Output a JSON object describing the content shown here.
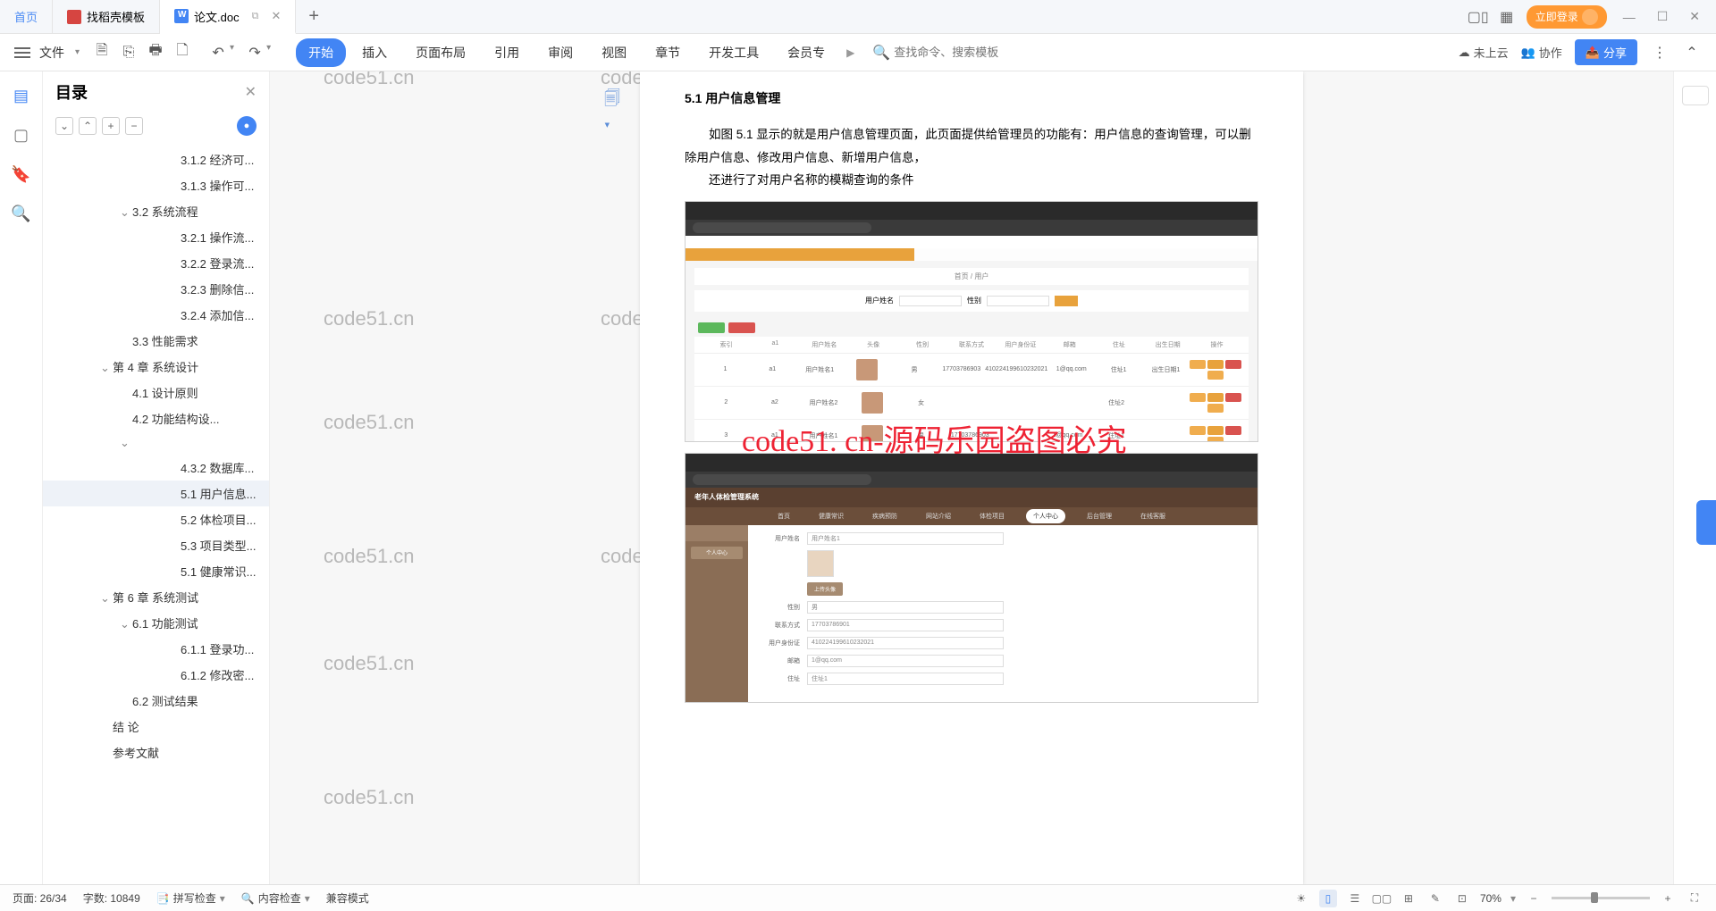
{
  "tabs": {
    "home": "首页",
    "t1": "找稻壳模板",
    "t2": "论文.doc"
  },
  "login_btn": "立即登录",
  "ribbon": {
    "file": "文件",
    "tabs": [
      "开始",
      "插入",
      "页面布局",
      "引用",
      "审阅",
      "视图",
      "章节",
      "开发工具",
      "会员专"
    ],
    "search_ph": "查找命令、搜索模板",
    "cloud": "未上云",
    "collab": "协作",
    "share": "分享"
  },
  "outline": {
    "title": "目录",
    "items": [
      {
        "lvl": "l4",
        "txt": "3.1.2 经济可...",
        "chev": false
      },
      {
        "lvl": "l4",
        "txt": "3.1.3 操作可...",
        "chev": false
      },
      {
        "lvl": "l2",
        "txt": "3.2 系统流程",
        "chev": true
      },
      {
        "lvl": "l4",
        "txt": "3.2.1 操作流...",
        "chev": false
      },
      {
        "lvl": "l4",
        "txt": "3.2.2 登录流...",
        "chev": false
      },
      {
        "lvl": "l4",
        "txt": "3.2.3 删除信...",
        "chev": false
      },
      {
        "lvl": "l4",
        "txt": "3.2.4 添加信...",
        "chev": false
      },
      {
        "lvl": "l2",
        "txt": "3.3 性能需求",
        "chev": false
      },
      {
        "lvl": "l1",
        "txt": "第 4 章 系统设计",
        "chev": true
      },
      {
        "lvl": "l2",
        "txt": "4.1 设计原则",
        "chev": false
      },
      {
        "lvl": "l2",
        "txt": "4.2 功能结构设...",
        "chev": false
      },
      {
        "lvl": "l2",
        "txt": "",
        "chev": true
      },
      {
        "lvl": "l4",
        "txt": "4.3.2 数据库...",
        "chev": false
      },
      {
        "lvl": "l4",
        "txt": "5.1 用户信息...",
        "chev": false,
        "sel": true
      },
      {
        "lvl": "l4",
        "txt": "5.2 体检项目...",
        "chev": false
      },
      {
        "lvl": "l4",
        "txt": "5.3 项目类型...",
        "chev": false
      },
      {
        "lvl": "l4",
        "txt": "5.1 健康常识...",
        "chev": false
      },
      {
        "lvl": "l1",
        "txt": "第 6 章 系统测试",
        "chev": true
      },
      {
        "lvl": "l2",
        "txt": "6.1 功能测试",
        "chev": true
      },
      {
        "lvl": "l4",
        "txt": "6.1.1 登录功...",
        "chev": false
      },
      {
        "lvl": "l4",
        "txt": "6.1.2 修改密...",
        "chev": false
      },
      {
        "lvl": "l2",
        "txt": "6.2 测试结果",
        "chev": false
      },
      {
        "lvl": "l1",
        "txt": "结  论",
        "chev": false
      },
      {
        "lvl": "l1",
        "txt": "参考文献",
        "chev": false
      }
    ]
  },
  "doc": {
    "heading": "5.1 用户信息管理",
    "p1": "如图 5.1 显示的就是用户信息管理页面，此页面提供给管理员的功能有：用户信息的查询管理，可以删除用户信息、修改用户信息、新增用户信息，",
    "p2": "还进行了对用户名称的模糊查询的条件",
    "sc1": {
      "breadcrumb": "首页 / 用户",
      "lbl1": "用户姓名",
      "lbl2": "性别",
      "cols": [
        "索引",
        "a1",
        "用户姓名",
        "头像",
        "性别",
        "联系方式",
        "用户身份证",
        "邮箱",
        "住址",
        "出生日期",
        "操作"
      ],
      "row_name": "用户姓名1",
      "gender": "男",
      "phone": "17703786903",
      "id": "410224199610232021",
      "email": "1@qq.com",
      "addr": "住址1",
      "bd": "出生日期1"
    },
    "sc2": {
      "title": "老年人体检管理系统",
      "menu": [
        "首页",
        "健康常识",
        "疾病预防",
        "网站介绍",
        "体检项目",
        "个人中心",
        "后台管理",
        "在线客服"
      ],
      "side": "个人中心",
      "f1": "用户姓名",
      "f1v": "用户姓名1",
      "upload": "上传头像",
      "f2": "性别",
      "f2v": "男",
      "f3": "联系方式",
      "f3v": "17703786901",
      "f4": "用户身份证",
      "f4v": "410224199610232021",
      "f5": "邮箱",
      "f5v": "1@qq.com",
      "f6": "住址",
      "f6v": "住址1"
    }
  },
  "overlay": "code51. cn-源码乐园盗图必究",
  "wm": "code51.cn",
  "status": {
    "page": "页面: 26/34",
    "words": "字数: 10849",
    "spell": "拼写检查",
    "content": "内容检查",
    "compat": "兼容模式",
    "zoom": "70%"
  }
}
